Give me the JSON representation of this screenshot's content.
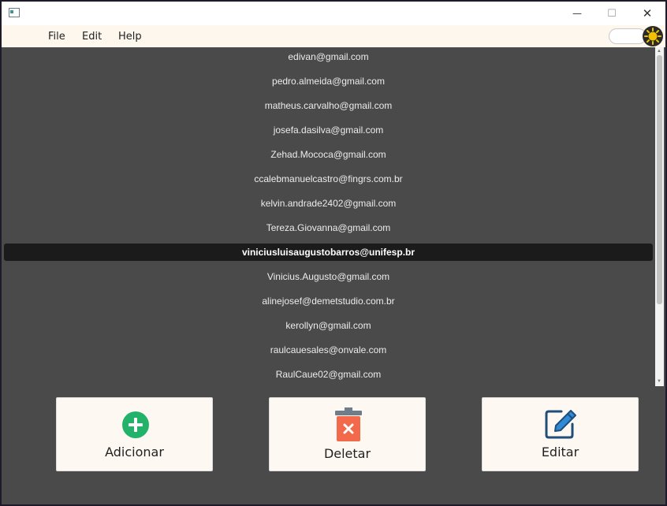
{
  "window": {
    "buttons": {
      "minimize": "—",
      "maximize": "☐",
      "close": "✕"
    }
  },
  "menu": {
    "items": [
      "File",
      "Edit",
      "Help"
    ]
  },
  "theme_toggle": {
    "icon": "sun-icon",
    "accent": "#f2c200"
  },
  "emails": {
    "selected_index": 8,
    "items": [
      "edivan@gmail.com",
      "pedro.almeida@gmail.com",
      "matheus.carvalho@gmail.com",
      "josefa.dasilva@gmail.com",
      "Zehad.Mococa@gmail.com",
      "ccalebmanuelcastro@fingrs.com.br",
      "kelvin.andrade2402@gmail.com",
      "Tereza.Giovanna@gmail.com",
      "viniciusluisaugustobarros@unifesp.br",
      "Vinicius.Augusto@gmail.com",
      "alinejosef@demetstudio.com.br",
      "kerollyn@gmail.com",
      "raulcauesales@onvale.com",
      "RaulCaue02@gmail.com"
    ]
  },
  "actions": {
    "add": {
      "label": "Adicionar",
      "icon": "plus-circle-icon",
      "color": "#22b26a"
    },
    "delete": {
      "label": "Deletar",
      "icon": "trash-icon",
      "color": "#f26a4b"
    },
    "edit": {
      "label": "Editar",
      "icon": "edit-icon",
      "color": "#1f4e79"
    }
  }
}
